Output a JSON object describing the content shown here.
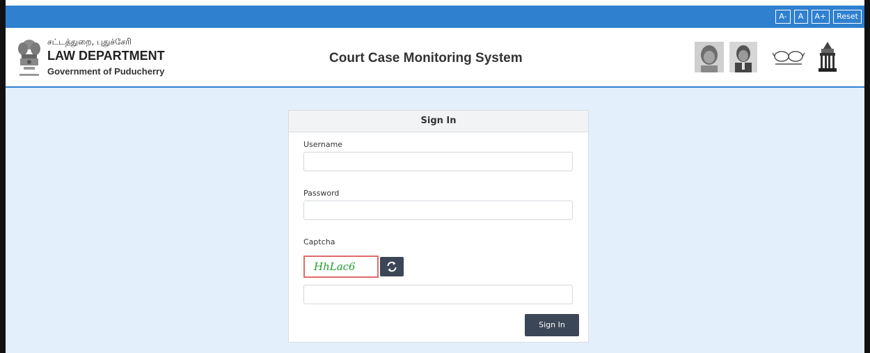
{
  "font_controls": [
    "A-",
    "A",
    "A+",
    "Reset"
  ],
  "header": {
    "dept_tamil": "சட்டத்துறை, புதுச்சேரி",
    "dept_name": "LAW DEPARTMENT",
    "government": "Government of Puducherry",
    "site_title": "Court Case Monitoring System",
    "icons": [
      "gandhi-portrait-icon",
      "ambedkar-portrait-icon",
      "swachh-bharat-glasses-icon",
      "legislature-building-icon"
    ]
  },
  "signin": {
    "title": "Sign In",
    "username_label": "Username",
    "username_value": "",
    "password_label": "Password",
    "password_value": "",
    "captcha_label": "Captcha",
    "captcha_text": "HhLac6",
    "captcha_value": "",
    "submit_label": "Sign In"
  },
  "colors": {
    "topbar": "#2f80cf",
    "page_background": "#e3effb",
    "dark_button": "#3b4656",
    "captcha_border": "#e06a6a",
    "captcha_text": "#1f9f2c"
  }
}
